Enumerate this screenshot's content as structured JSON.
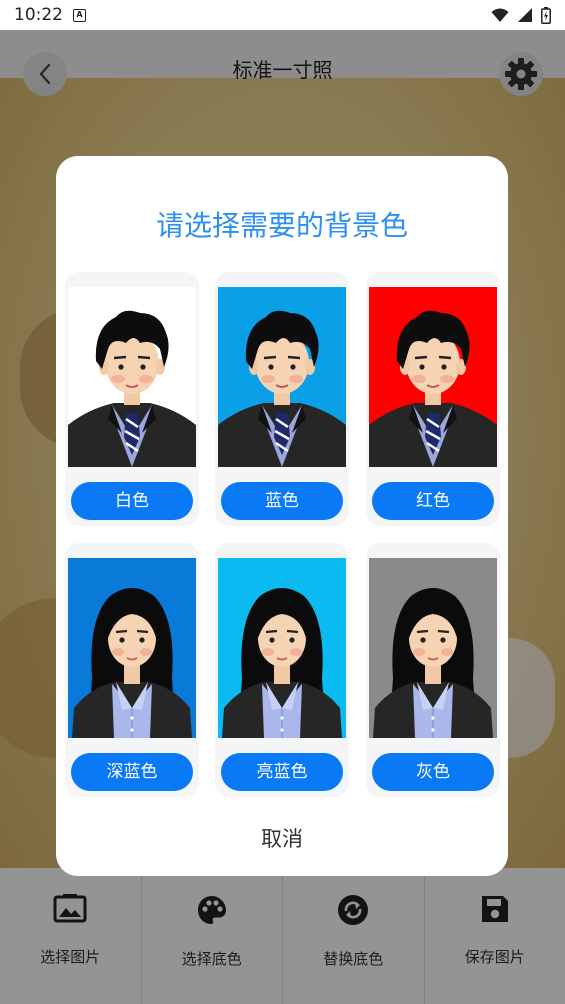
{
  "status_bar": {
    "time": "10:22",
    "badge": "A"
  },
  "header": {
    "title": "标准一寸照"
  },
  "dialog": {
    "title": "请选择需要的背景色",
    "cancel_label": "取消",
    "options": [
      {
        "label": "白色",
        "color": "#ffffff",
        "figure": "male"
      },
      {
        "label": "蓝色",
        "color": "#0aa0e8",
        "figure": "male"
      },
      {
        "label": "红色",
        "color": "#ff0000",
        "figure": "male"
      },
      {
        "label": "深蓝色",
        "color": "#0a7ad8",
        "figure": "female"
      },
      {
        "label": "亮蓝色",
        "color": "#0abaf0",
        "figure": "female"
      },
      {
        "label": "灰色",
        "color": "#8a8a8a",
        "figure": "female"
      }
    ]
  },
  "toolbar": {
    "items": [
      {
        "label": "选择图片",
        "icon": "image-icon"
      },
      {
        "label": "选择底色",
        "icon": "palette-icon"
      },
      {
        "label": "替换底色",
        "icon": "sync-icon"
      },
      {
        "label": "保存图片",
        "icon": "save-icon"
      }
    ]
  },
  "colors": {
    "accent": "#0a79f6",
    "title": "#2d8ff0"
  }
}
